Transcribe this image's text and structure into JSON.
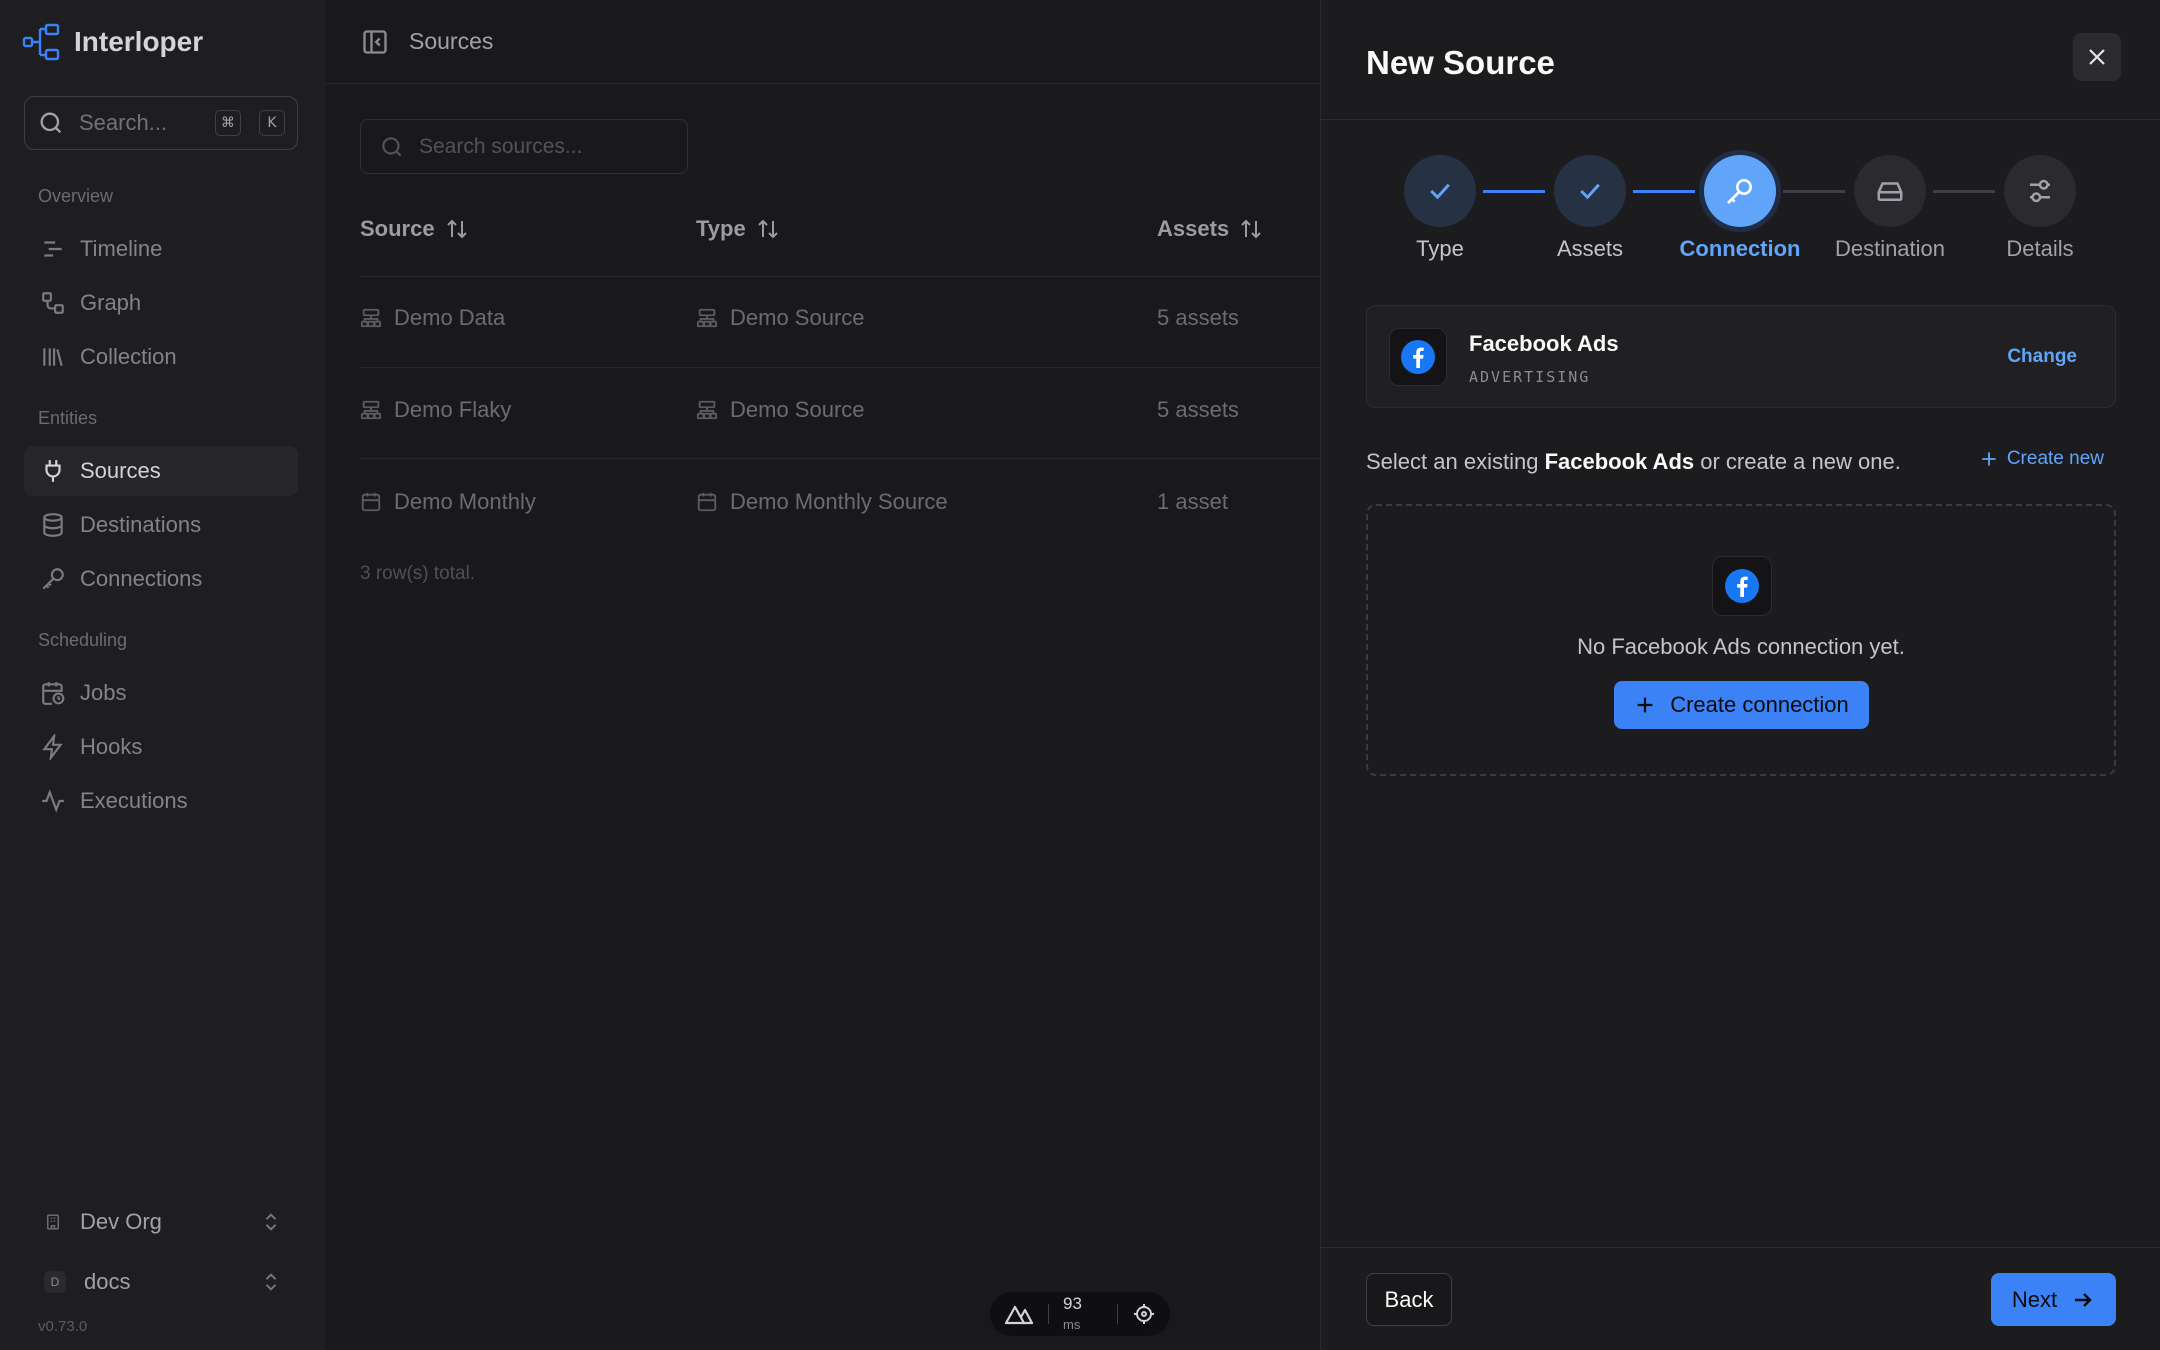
{
  "sidebar": {
    "brand": "Interloper",
    "search": {
      "placeholder": "Search...",
      "shortcut_mod": "⌘",
      "shortcut_key": "K"
    },
    "sections": {
      "overview": "Overview",
      "entities": "Entities",
      "scheduling": "Scheduling"
    },
    "items": {
      "timeline": "Timeline",
      "graph": "Graph",
      "collection": "Collection",
      "sources": "Sources",
      "destinations": "Destinations",
      "connections": "Connections",
      "jobs": "Jobs",
      "hooks": "Hooks",
      "executions": "Executions"
    },
    "org": {
      "name": "Dev Org"
    },
    "workspace": {
      "badge": "D",
      "name": "docs"
    },
    "version": "v0.73.0"
  },
  "main": {
    "title": "Sources",
    "search_placeholder": "Search sources...",
    "columns": {
      "source": "Source",
      "type": "Type",
      "assets": "Assets"
    },
    "rows": [
      {
        "source": "Demo Data",
        "type": "Demo Source",
        "assets": "5 assets",
        "icon": "sitemap-icon"
      },
      {
        "source": "Demo Flaky",
        "type": "Demo Source",
        "assets": "5 assets",
        "icon": "sitemap-icon"
      },
      {
        "source": "Demo Monthly",
        "type": "Demo Monthly Source",
        "assets": "1 asset",
        "icon": "calendar-icon"
      }
    ],
    "rows_total": "3 row(s) total.",
    "perf": {
      "value": "93",
      "unit": "ms"
    }
  },
  "drawer": {
    "title": "New Source",
    "steps": [
      {
        "label": "Type",
        "state": "done"
      },
      {
        "label": "Assets",
        "state": "done"
      },
      {
        "label": "Connection",
        "state": "current"
      },
      {
        "label": "Destination",
        "state": "todo"
      },
      {
        "label": "Details",
        "state": "todo"
      }
    ],
    "selected": {
      "name": "Facebook Ads",
      "category": "ADVERTISING",
      "change": "Change"
    },
    "prompt": {
      "prefix": "Select an existing",
      "name": "Facebook Ads",
      "suffix": "or create a new one."
    },
    "create_new": "Create new",
    "empty": {
      "text": "No Facebook Ads connection yet.",
      "button": "Create connection"
    },
    "back": "Back",
    "next": "Next"
  },
  "colors": {
    "accent": "#3b82f6",
    "accent_text": "#60a5fa",
    "facebook": "#1877f2"
  }
}
